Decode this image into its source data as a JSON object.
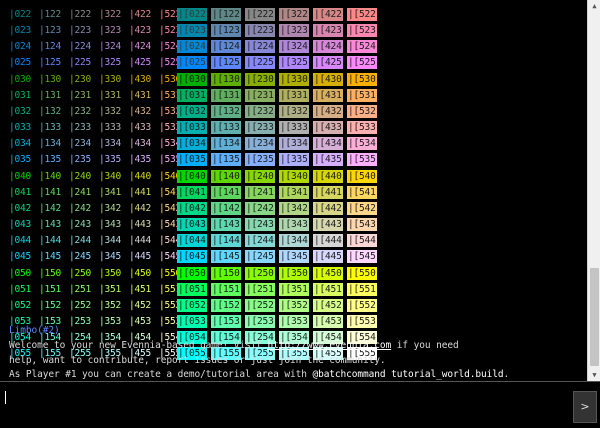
{
  "terminal": {
    "color_rows": [
      "022",
      "023",
      "024",
      "025",
      "030",
      "031",
      "032",
      "033",
      "034",
      "035",
      "040",
      "041",
      "042",
      "043",
      "044",
      "045",
      "050",
      "051",
      "052",
      "053",
      "054",
      "055"
    ],
    "messages": {
      "room": "Limbo(#2)",
      "line1_pre": "Welcome to your new Evennia-based game! Visit ",
      "line1_link": "http://www.evennia.com",
      "line1_post": " if you need",
      "line2": "help, want to contribute, report issues or just join the community.",
      "line3_pre": "As Player #1 you can create a demo/tutorial area with ",
      "line3_cmd": "@batchcommand tutorial_world.build",
      "line3_post": "."
    },
    "fg_prefix": "|",
    "bg_prefix": "|[",
    "room_color": "#5f87ff"
  },
  "input": {
    "value": "",
    "send_label": ">"
  },
  "scrollbar": {
    "up_icon": "▲",
    "down_icon": "▼"
  }
}
